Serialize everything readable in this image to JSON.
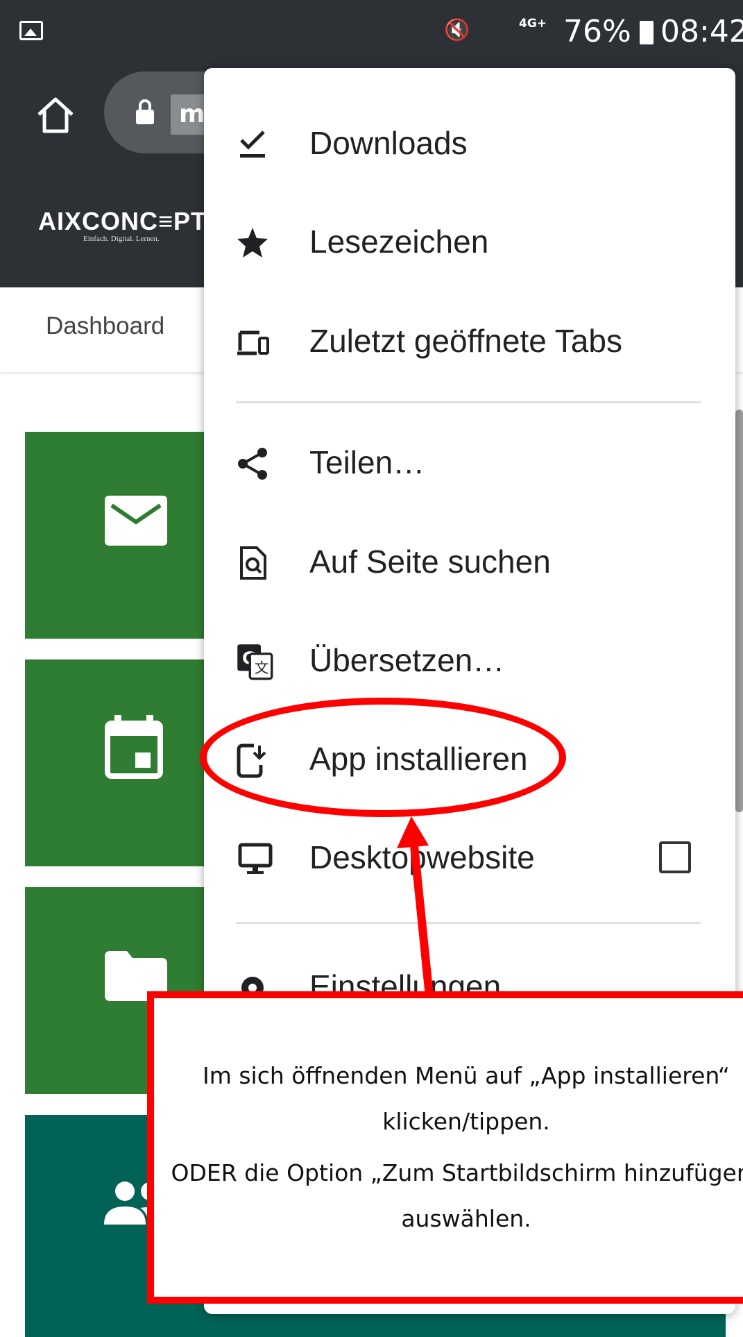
{
  "status_bar": {
    "network": "4G+",
    "battery": "76%",
    "time": "08:42"
  },
  "browser": {
    "url_visible": "m"
  },
  "site": {
    "logo": "AIXCONC≡PT",
    "logo_tagline": "Einfach. Digital. Lernen.",
    "breadcrumb": "Dashboard"
  },
  "menu": {
    "items": [
      {
        "label": "Downloads",
        "icon": "download-done-icon"
      },
      {
        "label": "Lesezeichen",
        "icon": "star-icon"
      },
      {
        "label": "Zuletzt geöffnete Tabs",
        "icon": "devices-icon"
      },
      {
        "label": "Teilen…",
        "icon": "share-icon"
      },
      {
        "label": "Auf Seite suchen",
        "icon": "find-in-page-icon"
      },
      {
        "label": "Übersetzen…",
        "icon": "translate-icon"
      },
      {
        "label": "App installieren",
        "icon": "install-mobile-icon"
      },
      {
        "label": "Desktopwebsite",
        "icon": "desktop-icon",
        "checked": false
      },
      {
        "label": "Einstellungen",
        "icon": "settings-icon"
      }
    ]
  },
  "annotation": {
    "color": "#ff0000",
    "line1": "Im sich öffnenden Menü auf „App installieren“",
    "line2": "klicken/tippen.",
    "line3": "ODER die Option „Zum Startbildschirm hinzufügen“",
    "line4": "auswählen."
  },
  "colors": {
    "toolbar": "#2d3034",
    "tile_green": "#2f7d32",
    "tile_teal": "#006356"
  }
}
